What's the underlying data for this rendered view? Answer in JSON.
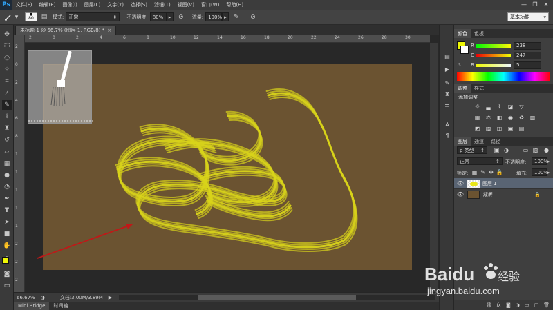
{
  "menubar": {
    "logo": "Ps",
    "items": [
      "文件(F)",
      "编辑(E)",
      "图像(I)",
      "图层(L)",
      "文字(Y)",
      "选择(S)",
      "滤镜(T)",
      "视图(V)",
      "窗口(W)",
      "帮助(H)"
    ],
    "minimize": "—",
    "restore": "❐",
    "close": "✕"
  },
  "options": {
    "brush_size": "80",
    "mode_label": "模式:",
    "mode_value": "正常",
    "opacity_label": "不透明度:",
    "opacity_value": "80%",
    "flow_label": "流量:",
    "flow_value": "100%",
    "workspace": "基本功能"
  },
  "document": {
    "tab_title": "未标题-1 @ 66.7% (图层 1, RGB/8) *",
    "tab_close": "×"
  },
  "rulers": {
    "top": [
      "2",
      "0",
      "2",
      "4",
      "6",
      "8",
      "10",
      "12",
      "14",
      "16",
      "18",
      "20",
      "22",
      "24",
      "26",
      "28",
      "30"
    ],
    "left": [
      "2",
      "0",
      "2",
      "4",
      "6",
      "8",
      "1",
      "1",
      "1",
      "1",
      "1",
      "2",
      "2",
      "2"
    ]
  },
  "status": {
    "zoom": "66.67%",
    "doc_size": "文档:3.00M/3.89M",
    "arrow": "▶"
  },
  "bottom_tabs": [
    "Mini Bridge",
    "时间轴"
  ],
  "color_panel": {
    "tabs": [
      "颜色",
      "色板"
    ],
    "r_label": "R",
    "r_value": "238",
    "g_label": "G",
    "g_value": "247",
    "b_label": "B",
    "b_value": "5",
    "fg_color": "#eef705"
  },
  "adjust_panel": {
    "tabs": [
      "调整",
      "样式"
    ],
    "title": "添加调整"
  },
  "layers_panel": {
    "tabs": [
      "图层",
      "通道",
      "路径"
    ],
    "filter": "ρ 类型",
    "blend_mode": "正常",
    "opacity_label": "不透明度:",
    "opacity_value": "100%",
    "lock_label": "锁定:",
    "fill_label": "填充:",
    "fill_value": "100%",
    "layers": [
      {
        "name": "图层 1",
        "selected": true
      },
      {
        "name": "背景",
        "selected": false
      }
    ],
    "footer_icons": [
      "link-icon",
      "fx-icon",
      "mask-icon",
      "adjustment-icon",
      "folder-icon",
      "new-layer-icon",
      "trash-icon"
    ]
  },
  "watermark": {
    "brand": "Baidu",
    "cn": "经验",
    "url": "jingyan.baidu.com"
  },
  "colors": {
    "canvas": "#6b5331",
    "stroke": "#e8e617",
    "arrow": "#c01818"
  }
}
